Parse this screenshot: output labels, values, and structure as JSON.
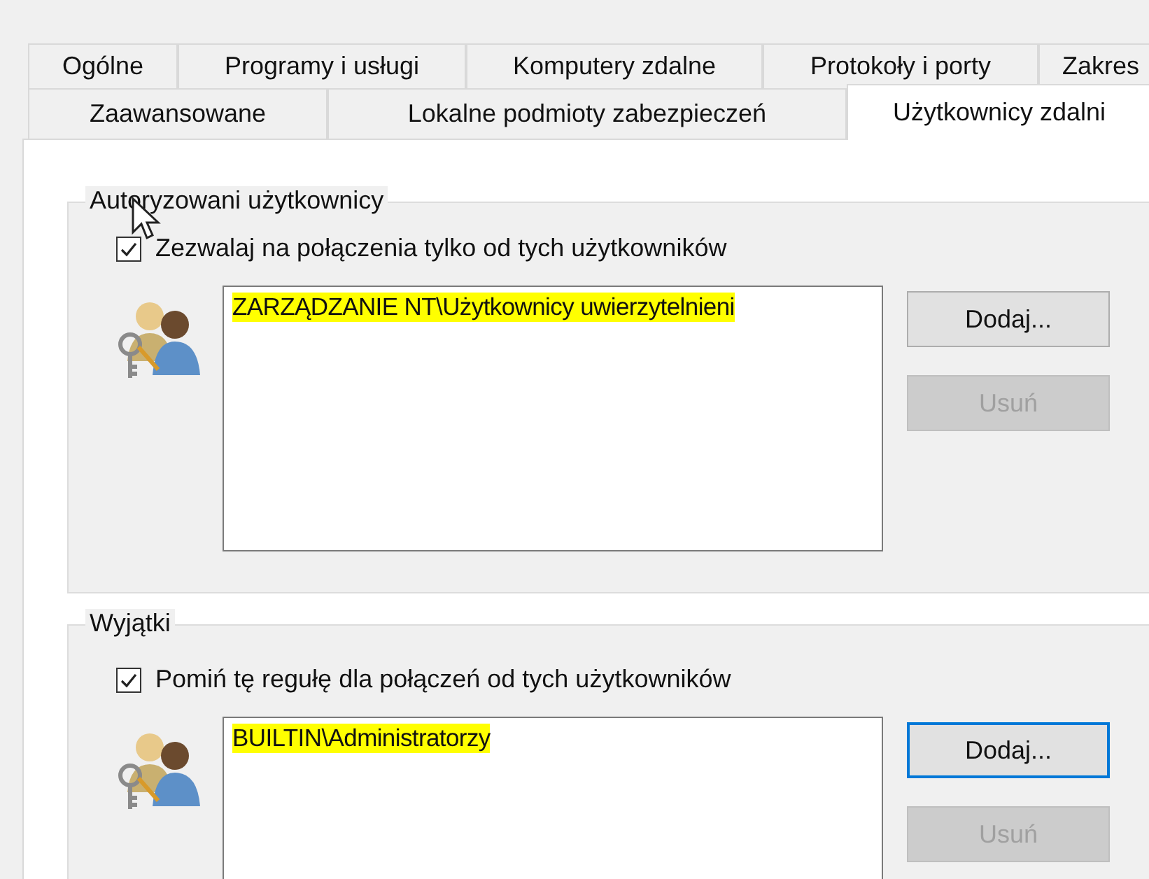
{
  "tabs_row_1": [
    {
      "label": "Ogólne",
      "selected": false
    },
    {
      "label": "Programy i usługi",
      "selected": false
    },
    {
      "label": "Komputery zdalne",
      "selected": false
    },
    {
      "label": "Protokoły i porty",
      "selected": false
    },
    {
      "label": "Zakres",
      "selected": false
    }
  ],
  "tabs_row_2": [
    {
      "label": "Zaawansowane",
      "selected": false
    },
    {
      "label": "Lokalne podmioty zabezpieczeń",
      "selected": false
    },
    {
      "label": "Użytkownicy zdalni",
      "selected": true
    }
  ],
  "groups": [
    {
      "title": "Autoryzowani użytkownicy",
      "checkbox": {
        "label": "Zezwalaj na połączenia tylko od tych użytkowników",
        "checked": true
      },
      "users": [
        {
          "text": "ZARZĄDZANIE NT\\Użytkownicy uwierzytelnieni",
          "highlighted": true
        }
      ],
      "buttons": [
        {
          "label": "Dodaj...",
          "disabled": false,
          "focused": false
        },
        {
          "label": "Usuń",
          "disabled": true,
          "focused": false
        }
      ]
    },
    {
      "title": "Wyjątki",
      "checkbox": {
        "label": "Pomiń tę regułę dla połączeń od tych użytkowników",
        "checked": true
      },
      "users": [
        {
          "text": "BUILTIN\\Administratorzy",
          "highlighted": true
        }
      ],
      "buttons": [
        {
          "label": "Dodaj...",
          "disabled": false,
          "focused": true
        },
        {
          "label": "Usuń",
          "disabled": true,
          "focused": false
        }
      ]
    }
  ]
}
